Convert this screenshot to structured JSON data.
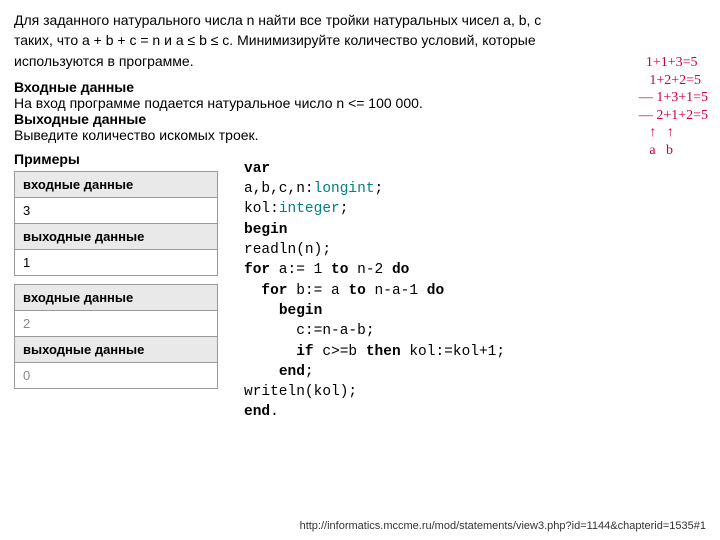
{
  "problem": {
    "para": "Для заданного натурального числа n найти все тройки натуральных чисел a, b, c таких, что a + b + c = n и a ≤ b ≤ c. Минимизируйте количество условий, которые используются в программе.",
    "input_title": "Входные данные",
    "input_text": "На вход программе подается натуральное число n <= 100 000.",
    "output_title": "Выходные данные",
    "output_text": "Выведите количество искомых троек."
  },
  "handwriting": "  1+1+3=5\n   1+2+2=5\n— 1+3+1=5\n— 2+1+2=5\n   ↑   ↑\n   a   b",
  "examples": {
    "title": "Примеры",
    "hdr_in": "входные данные",
    "hdr_out": "выходные данные",
    "rows": [
      {
        "in": "3",
        "out": "1"
      },
      {
        "in": "2",
        "out": "0"
      }
    ]
  },
  "code": {
    "l1a": "var",
    "l2a": "a,b,c,n:",
    "l2b": "longint",
    "l2c": ";",
    "l3a": "kol:",
    "l3b": "integer",
    "l3c": ";",
    "l4a": "begin",
    "l5a": "readln(n);",
    "l6a": "for",
    "l6b": " a:= 1 ",
    "l6c": "to",
    "l6d": " n-2 ",
    "l6e": "do",
    "l7a": "for",
    "l7b": " b:= a ",
    "l7c": "to",
    "l7d": " n-a-1 ",
    "l7e": "do",
    "l8a": "begin",
    "l9a": "c:=n-a-b;",
    "l10a": "if",
    "l10b": " c>=b ",
    "l10c": "then",
    "l10d": " kol:=kol+1;",
    "l11a": "end",
    "l11b": ";",
    "l12a": "writeln(kol);",
    "l13a": "end",
    "l13b": "."
  },
  "footer": "http://informatics.mccme.ru/mod/statements/view3.php?id=1144&chapterid=1535#1"
}
